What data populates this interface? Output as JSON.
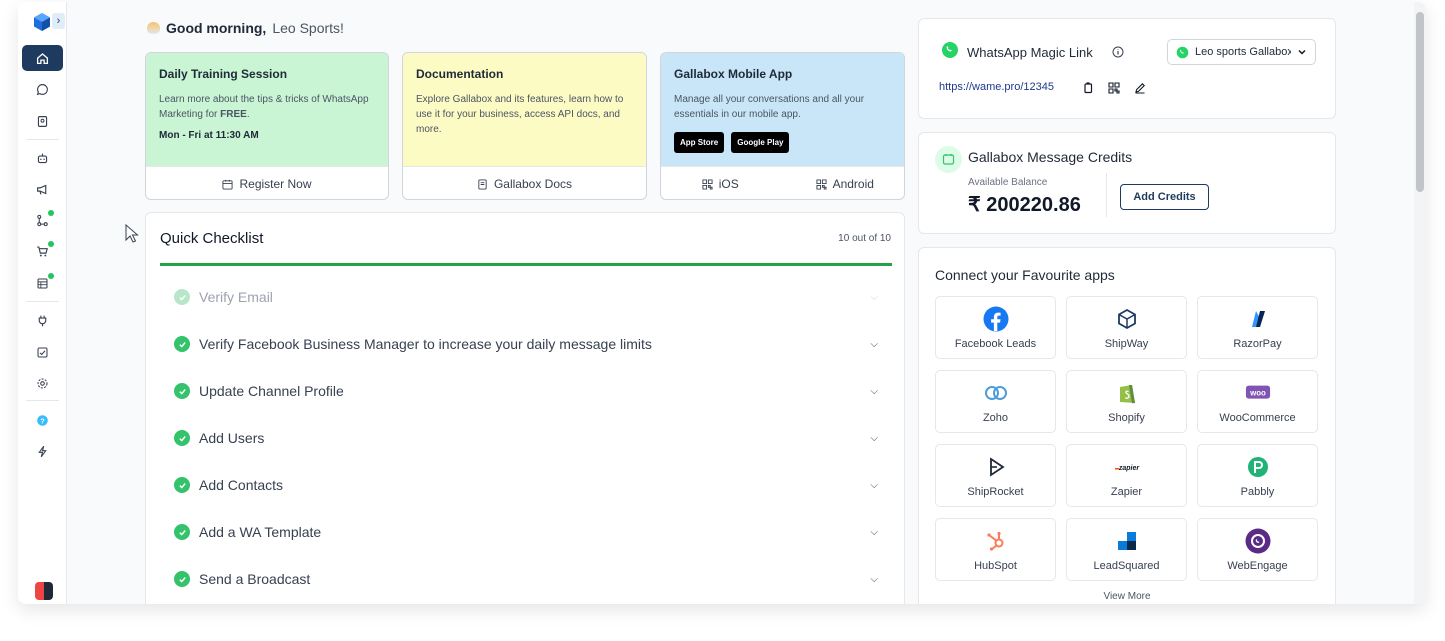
{
  "greeting": {
    "prefix": "Good morning,",
    "name": "Leo Sports!"
  },
  "cards": [
    {
      "title": "Daily Training Session",
      "body_start": "Learn more about the tips & tricks of WhatsApp Marketing for ",
      "body_bold": "FREE",
      "body_end": ".",
      "time": "Mon - Fri at 11:30 AM",
      "action": "Register Now",
      "color": "#c9f5d4"
    },
    {
      "title": "Documentation",
      "body": "Explore Gallabox and its features, learn how to use it for your business, access API docs, and more.",
      "action": "Gallabox Docs",
      "color": "#fdfbc4"
    },
    {
      "title": "Gallabox Mobile App",
      "body": "Manage all your conversations and all your essentials in our mobile app.",
      "app_store": "App Store",
      "google_play": "Google Play",
      "action_ios": "iOS",
      "action_android": "Android",
      "color": "#c8e6f8"
    }
  ],
  "checklist": {
    "title": "Quick Checklist",
    "count": "10 out of 10",
    "items": [
      {
        "label": "Verify Email"
      },
      {
        "label": "Verify Facebook Business Manager to increase your daily message limits"
      },
      {
        "label": "Update Channel Profile"
      },
      {
        "label": "Add Users"
      },
      {
        "label": "Add Contacts"
      },
      {
        "label": "Add a WA Template"
      },
      {
        "label": "Send a Broadcast"
      }
    ]
  },
  "whatsapp": {
    "title": "WhatsApp Magic Link",
    "selected": "Leo sports Gallabox",
    "link": "https://wame.pro/12345"
  },
  "credits": {
    "title": "Gallabox Message Credits",
    "balance_label": "Available Balance",
    "balance": "₹ 200220.86",
    "add_label": "Add Credits"
  },
  "apps": {
    "title": "Connect your Favourite apps",
    "items": [
      {
        "name": "Facebook Leads",
        "icon": "facebook-icon"
      },
      {
        "name": "ShipWay",
        "icon": "shipway-icon"
      },
      {
        "name": "RazorPay",
        "icon": "razorpay-icon"
      },
      {
        "name": "Zoho",
        "icon": "zoho-icon"
      },
      {
        "name": "Shopify",
        "icon": "shopify-icon"
      },
      {
        "name": "WooCommerce",
        "icon": "woocommerce-icon"
      },
      {
        "name": "ShipRocket",
        "icon": "shiprocket-icon"
      },
      {
        "name": "Zapier",
        "icon": "zapier-icon"
      },
      {
        "name": "Pabbly",
        "icon": "pabbly-icon"
      },
      {
        "name": "HubSpot",
        "icon": "hubspot-icon"
      },
      {
        "name": "LeadSquared",
        "icon": "leadsquared-icon"
      },
      {
        "name": "WebEngage",
        "icon": "webengage-icon"
      }
    ],
    "view_more": "View More"
  },
  "colors": {
    "accent": "#1e3a5f",
    "success": "#34c26b",
    "whatsapp": "#25d366"
  }
}
